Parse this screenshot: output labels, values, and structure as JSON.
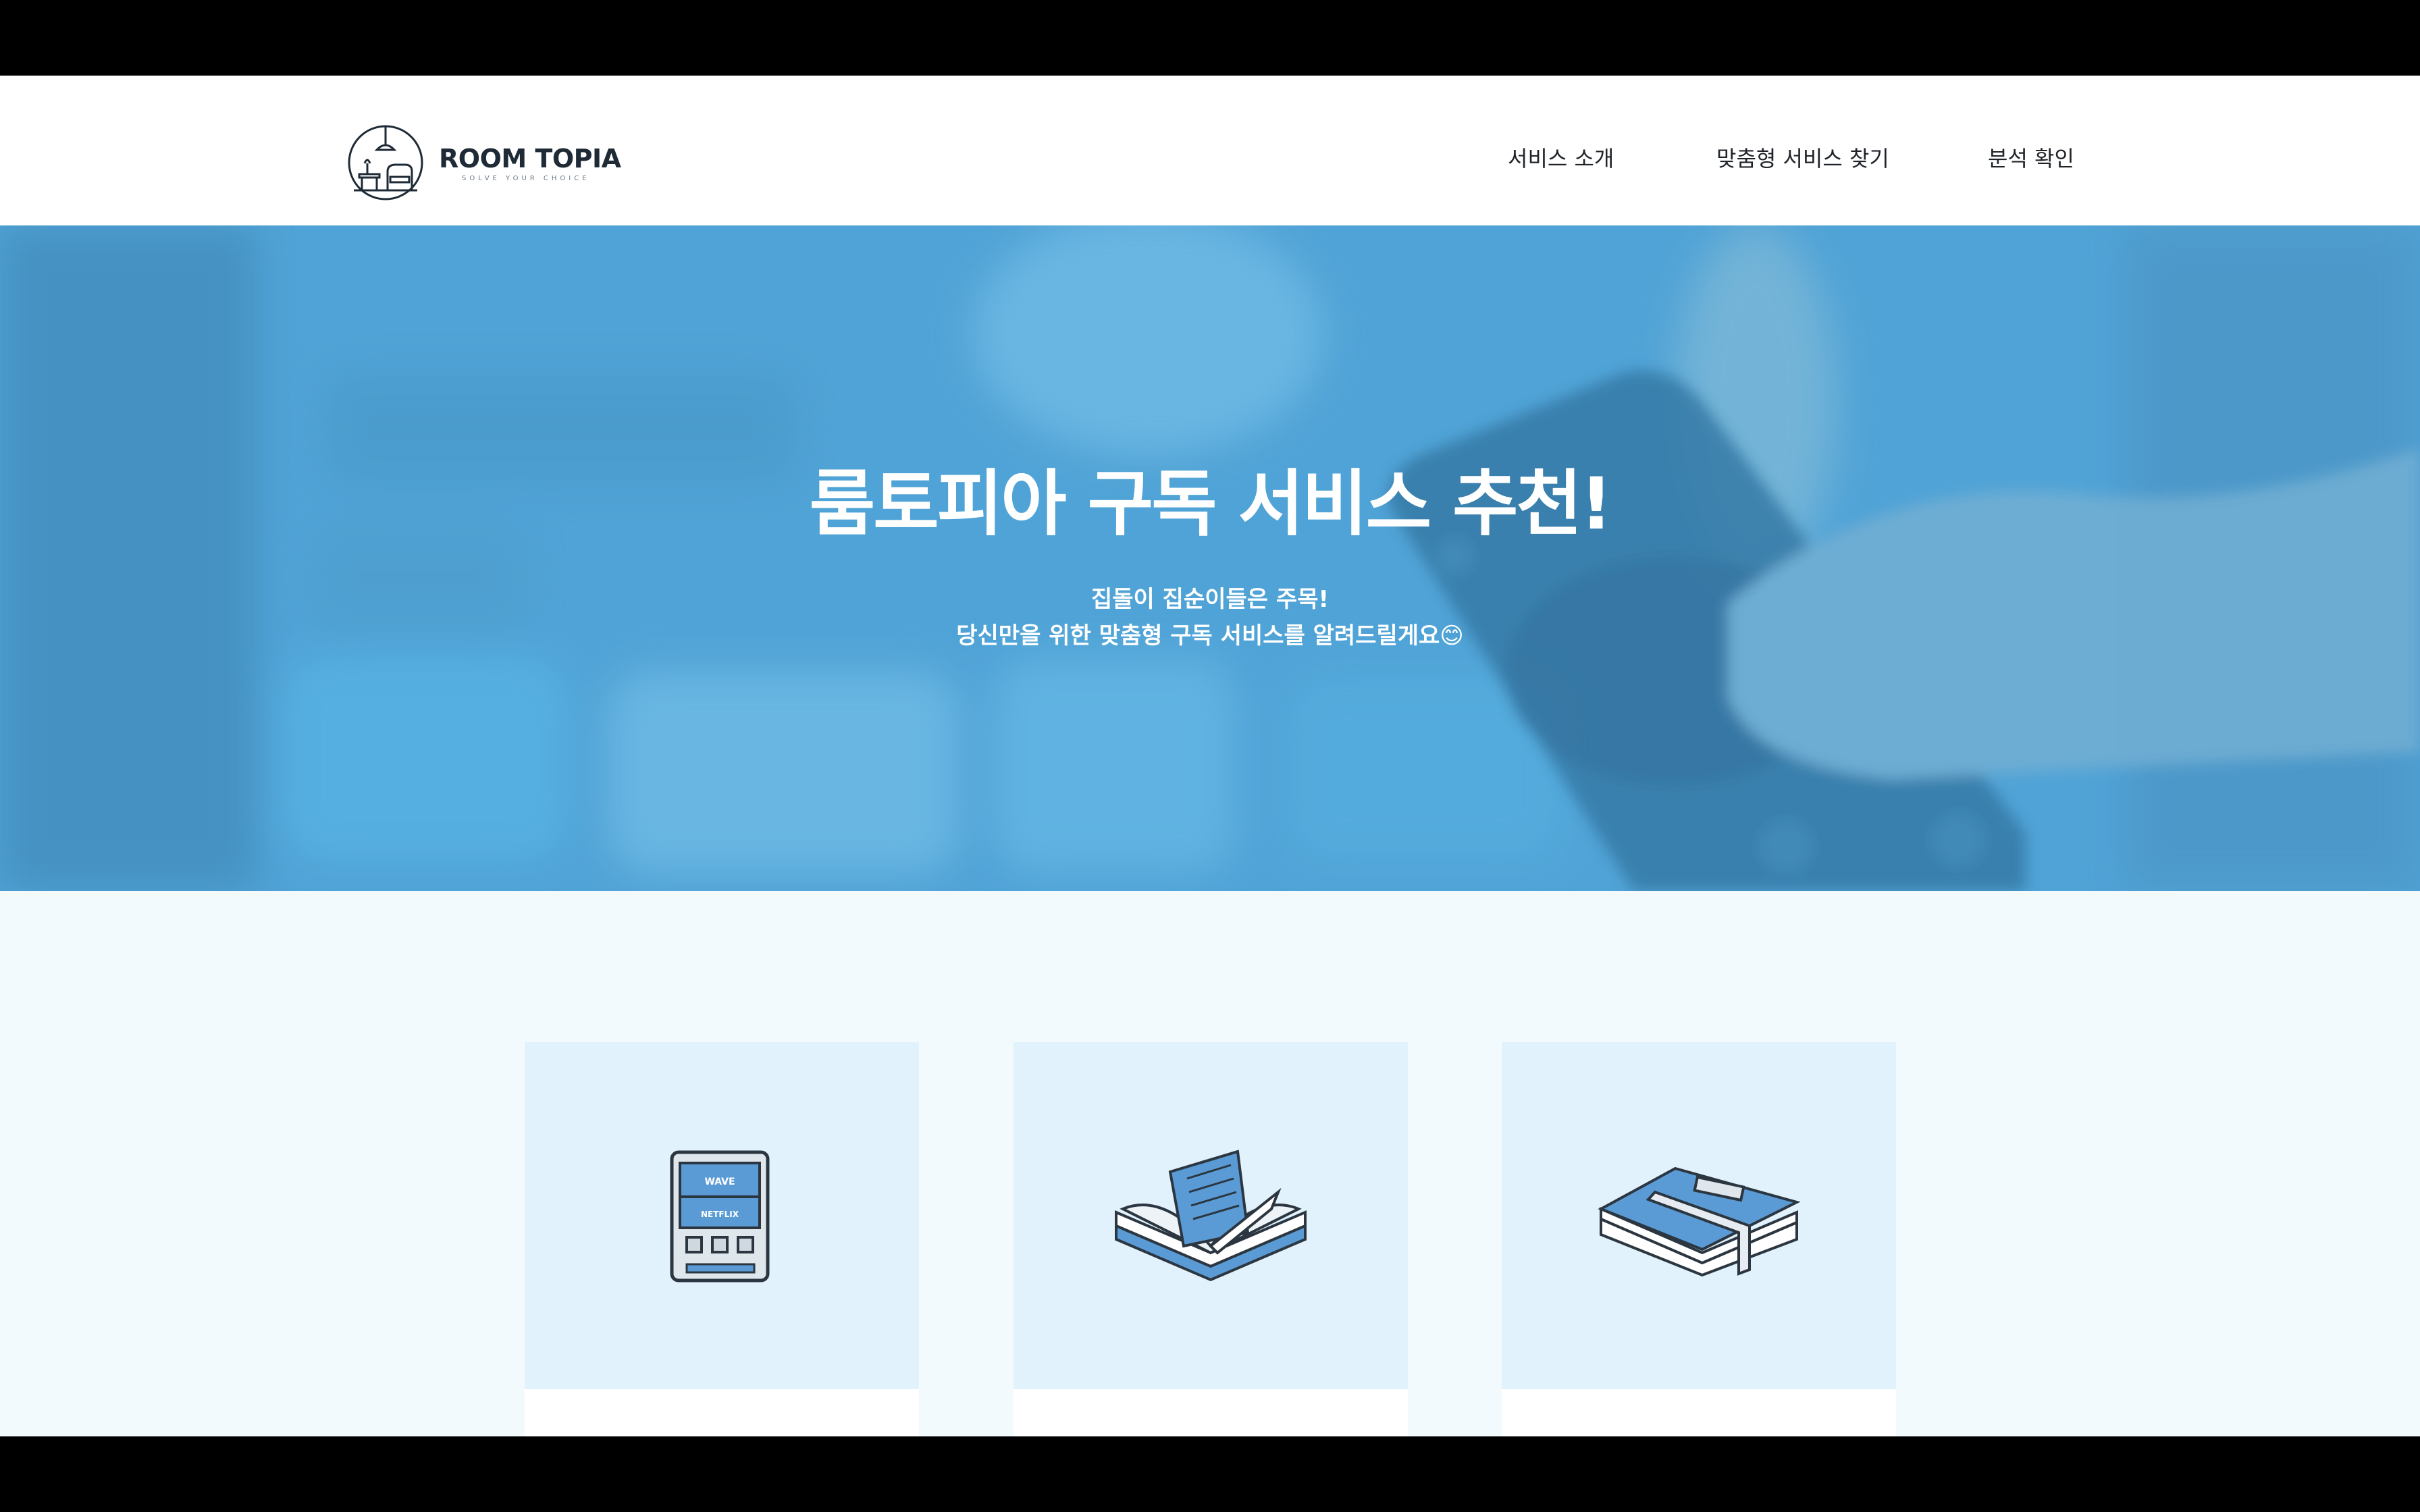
{
  "brand": {
    "name": "ROOM TOPIA",
    "tagline": "SOLVE YOUR CHOICE"
  },
  "nav": {
    "items": [
      {
        "label": "서비스 소개"
      },
      {
        "label": "맞춤형 서비스 찾기"
      },
      {
        "label": "분석 확인"
      }
    ]
  },
  "hero": {
    "title": "룸토피아 구독 서비스 추천!",
    "subtitle_line1": "집돌이 집순이들은 주목!",
    "subtitle_line2": "당신만을 위한 맞춤형 구독 서비스를 알려드릴게요😊"
  },
  "cards": [
    {
      "icon": "tablet-streaming-icon",
      "screen_labels": [
        "WAVE",
        "NETFLIX"
      ]
    },
    {
      "icon": "open-book-icon"
    },
    {
      "icon": "stacked-books-icon"
    }
  ],
  "colors": {
    "accent": "#5b9bd5",
    "hero_overlay": "#4aa3d8",
    "card_bg": "#e1f2fc",
    "page_bg": "#f3fafe"
  }
}
